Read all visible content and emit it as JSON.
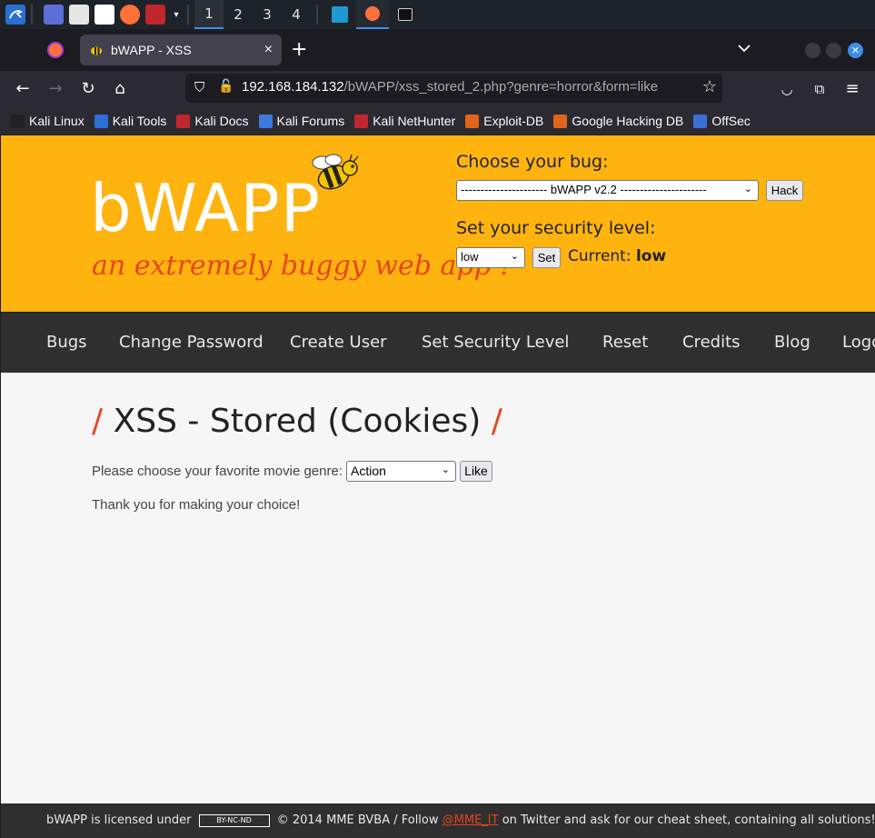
{
  "taskbar": {
    "workspaces": [
      "1",
      "2",
      "3",
      "4"
    ],
    "active_workspace": "1"
  },
  "browser": {
    "tab_title": "bWAPP - XSS",
    "url_host": "192.168.184.132",
    "url_path": "/bWAPP/xss_stored_2.php?genre=horror&form=like",
    "bookmarks": [
      {
        "label": "Kali Linux",
        "color": "#222222"
      },
      {
        "label": "Kali Tools",
        "color": "#2c6fd6"
      },
      {
        "label": "Kali Docs",
        "color": "#c0262d"
      },
      {
        "label": "Kali Forums",
        "color": "#3b7bdc"
      },
      {
        "label": "Kali NetHunter",
        "color": "#c0262d"
      },
      {
        "label": "Exploit-DB",
        "color": "#e0651a"
      },
      {
        "label": "Google Hacking DB",
        "color": "#e0651a"
      },
      {
        "label": "OffSec",
        "color": "#3b6fd6"
      }
    ]
  },
  "header": {
    "logo": "bWAPP",
    "tagline": "an extremely buggy web app !",
    "choose_bug_label": "Choose your bug:",
    "bug_select_value": "---------------------- bWAPP v2.2 ----------------------",
    "hack_button": "Hack",
    "security_label": "Set your security level:",
    "security_select_value": "low",
    "set_button": "Set",
    "current_label": "Current:",
    "current_value": "low"
  },
  "menu": [
    "Bugs",
    "Change Password",
    "Create User",
    "Set Security Level",
    "Reset",
    "Credits",
    "Blog",
    "Logout"
  ],
  "main": {
    "title": "XSS - Stored (Cookies)",
    "prompt": "Please choose your favorite movie genre:",
    "genre_select_value": "Action",
    "like_button": "Like",
    "message": "Thank you for making your choice!"
  },
  "footer": {
    "text_1": "bWAPP is licensed under",
    "cc_badge": "BY-NC-ND",
    "text_2": "© 2014 MME BVBA / Follow",
    "twitter_link": "@MME_IT",
    "text_3": "on Twitter and ask for our cheat sheet, containing all solutions! / Need"
  },
  "colors": {
    "header_bg": "#ffb30f",
    "accent": "#e6461c",
    "menu_bg": "#2f2f2f",
    "taskbar_accent": "#3e8ee8"
  }
}
